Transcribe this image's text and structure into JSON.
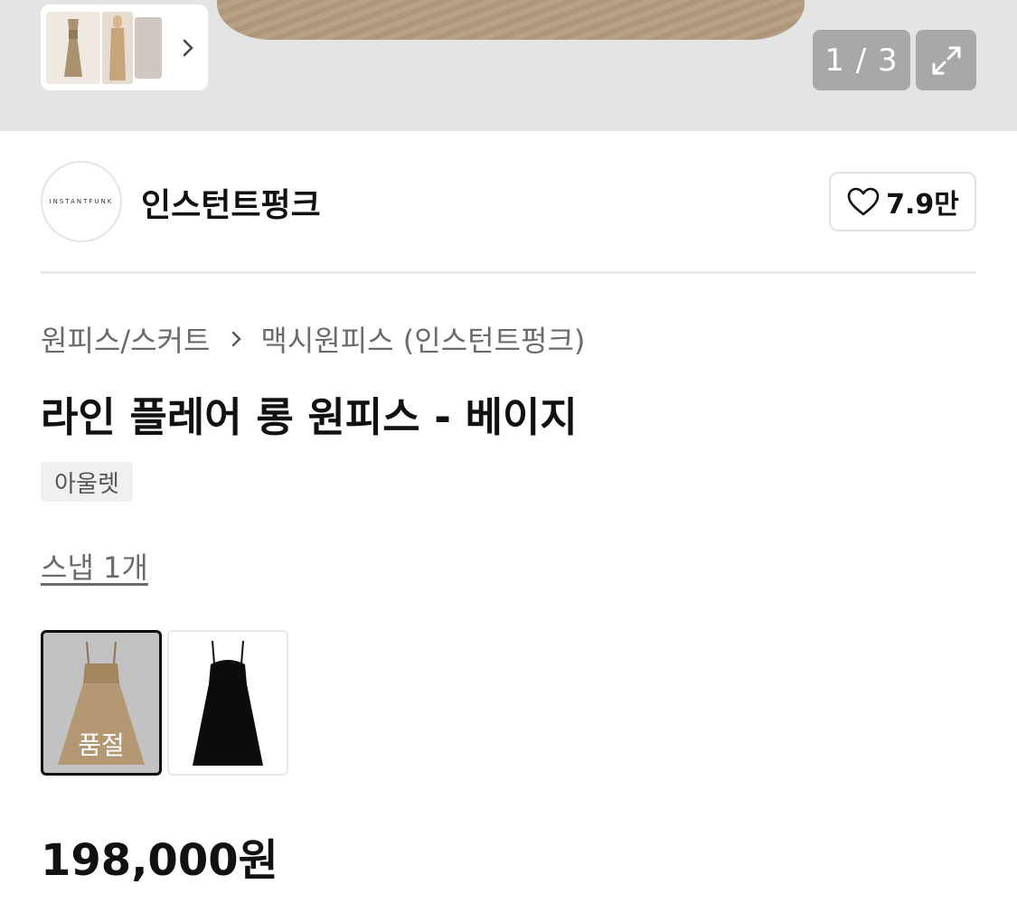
{
  "gallery": {
    "counter": "1 / 3",
    "icons": {
      "next": "chevron-right-icon",
      "expand": "expand-icon"
    }
  },
  "brand": {
    "logo_text": "INSTANTFUNK",
    "name": "인스턴트펑크",
    "like_count": "7.9만",
    "like_icon": "heart-outline-icon"
  },
  "breadcrumb": {
    "category": "원피스/스커트",
    "subcategory": "맥시원피스 (인스턴트펑크)"
  },
  "product": {
    "title": "라인 플레어 롱 원피스 - 베이지",
    "tag": "아울렛",
    "snap_link": "스냅 1개",
    "options": [
      {
        "color": "beige",
        "status": "품절"
      },
      {
        "color": "black",
        "status": ""
      }
    ],
    "price": "198,000원"
  },
  "colors": {
    "gallery_bg": "#e4e4e4",
    "counter_bg": "#a8a8a8",
    "muted_text": "#6b6b6b",
    "selected_border": "#111111"
  }
}
